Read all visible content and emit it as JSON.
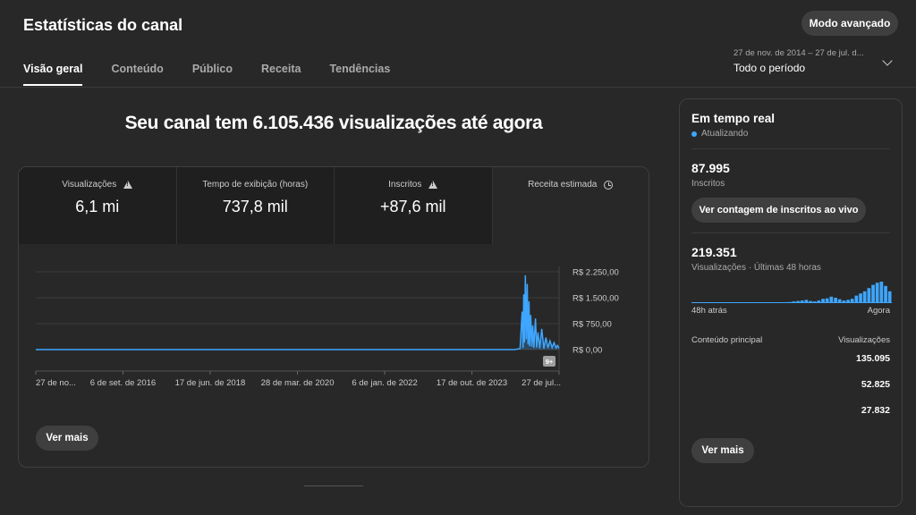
{
  "header": {
    "title": "Estatísticas do canal",
    "advanced_mode": "Modo avançado",
    "tabs": [
      {
        "label": "Visão geral",
        "active": true
      },
      {
        "label": "Conteúdo",
        "active": false
      },
      {
        "label": "Público",
        "active": false
      },
      {
        "label": "Receita",
        "active": false
      },
      {
        "label": "Tendências",
        "active": false
      }
    ],
    "date_range": {
      "dates": "27 de nov. de 2014 – 27 de jul. d...",
      "label": "Todo o período"
    }
  },
  "headline": "Seu canal tem 6.105.436 visualizações até agora",
  "metrics": [
    {
      "label": "Visualizações",
      "value": "6,1 mi",
      "icon": "warning-icon"
    },
    {
      "label": "Tempo de exibição (horas)",
      "value": "737,8 mil",
      "icon": ""
    },
    {
      "label": "Inscritos",
      "value": "+87,6 mil",
      "icon": "warning-icon"
    },
    {
      "label": "Receita estimada",
      "value": "",
      "icon": "clock-icon"
    }
  ],
  "chart_data": {
    "type": "line",
    "y_tick_labels": [
      "R$ 2.250,00",
      "R$ 1.500,00",
      "R$ 750,00",
      "R$ 0,00"
    ],
    "y_ticks": [
      2250,
      1500,
      750,
      0
    ],
    "ylim": [
      0,
      2250
    ],
    "x_tick_labels": [
      "27 de no...",
      "6 de set. de 2016",
      "17 de jun. de 2018",
      "28 de mar. de 2020",
      "6 de jan. de 2022",
      "17 de out. de 2023",
      "27 de jul..."
    ],
    "x_tick_dates": [
      "2014-11-27",
      "2016-09-06",
      "2018-06-17",
      "2020-03-28",
      "2022-01-06",
      "2023-10-17",
      "2025-07-27"
    ],
    "grid": true,
    "color": "#3ea6ff",
    "badge": "9+",
    "series": [
      {
        "x": [
          "2014-11-27",
          "2016-01-01",
          "2017-06-01",
          "2019-01-01",
          "2020-06-01",
          "2022-01-01",
          "2023-06-01",
          "2024-09-01",
          "2024-10-10",
          "2024-10-25",
          "2024-11-01",
          "2024-11-06",
          "2024-11-12",
          "2024-11-18",
          "2024-11-25",
          "2024-12-02",
          "2024-12-08",
          "2024-12-15",
          "2024-12-20",
          "2024-12-28",
          "2025-01-05",
          "2025-01-12",
          "2025-01-20",
          "2025-02-01",
          "2025-02-10",
          "2025-02-20",
          "2025-03-05",
          "2025-03-20",
          "2025-04-05",
          "2025-04-20",
          "2025-05-05",
          "2025-05-20",
          "2025-06-05",
          "2025-06-20",
          "2025-07-05",
          "2025-07-15",
          "2025-07-27"
        ],
        "values": [
          0,
          0,
          0,
          0,
          0,
          0,
          0,
          0,
          30,
          1100,
          50,
          1600,
          200,
          2150,
          300,
          1900,
          150,
          1400,
          100,
          1000,
          80,
          700,
          50,
          900,
          60,
          500,
          40,
          600,
          30,
          350,
          50,
          250,
          60,
          200,
          50,
          120,
          40
        ]
      }
    ]
  },
  "main_card": {
    "see_more": "Ver mais"
  },
  "realtime": {
    "title": "Em tempo real",
    "status": "Atualizando",
    "subscribers_value": "87.995",
    "subscribers_label": "Inscritos",
    "live_count_button": "Ver contagem de inscritos ao vivo",
    "views_value": "219.351",
    "views_label": "Visualizações · Últimas 48 horas",
    "hourly_views": [
      0.02,
      0.02,
      0.02,
      0.02,
      0.02,
      0.02,
      0.02,
      0.02,
      0.02,
      0.02,
      0.02,
      0.02,
      0.02,
      0.02,
      0.02,
      0.02,
      0.02,
      0.02,
      0.02,
      0.02,
      0.02,
      0.02,
      0.03,
      0.05,
      0.08,
      0.1,
      0.12,
      0.15,
      0.1,
      0.08,
      0.12,
      0.2,
      0.22,
      0.3,
      0.25,
      0.18,
      0.12,
      0.15,
      0.2,
      0.35,
      0.45,
      0.55,
      0.7,
      0.85,
      0.95,
      1.0,
      0.8,
      0.55
    ],
    "axis_start": "48h atrás",
    "axis_end": "Agora",
    "table_col1": "Conteúdo principal",
    "table_col2": "Visualizações",
    "rows": [
      "135.095",
      "52.825",
      "27.832"
    ],
    "see_more": "Ver mais"
  }
}
